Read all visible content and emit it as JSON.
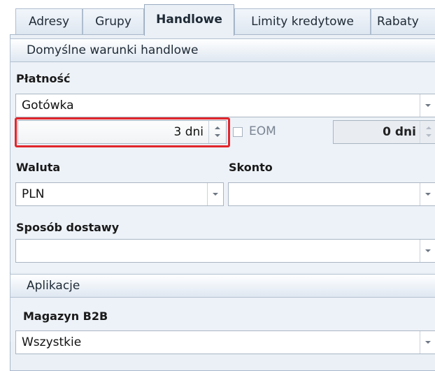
{
  "tabs": [
    {
      "label": "Adresy",
      "active": false
    },
    {
      "label": "Grupy",
      "active": false
    },
    {
      "label": "Handlowe",
      "active": true
    },
    {
      "label": "Limity kredytowe",
      "active": false
    },
    {
      "label": "Rabaty",
      "active": false
    }
  ],
  "trade_group": {
    "title": "Domyślne warunki handlowe",
    "payment": {
      "label": "Płatność",
      "value": "Gotówka",
      "days_value": "3 dni",
      "eom_label": "EOM",
      "eom_checked": false,
      "eom_days_value": "0 dni"
    },
    "currency": {
      "label": "Waluta",
      "value": "PLN"
    },
    "discount": {
      "label": "Skonto",
      "value": ""
    },
    "delivery": {
      "label": "Sposób dostawy",
      "value": ""
    }
  },
  "app_group": {
    "title": "Aplikacje",
    "warehouse": {
      "label": "Magazyn B2B",
      "value": "Wszystkie"
    }
  },
  "colors": {
    "highlight": "#e1262c",
    "panel": "#eaf0f6"
  }
}
